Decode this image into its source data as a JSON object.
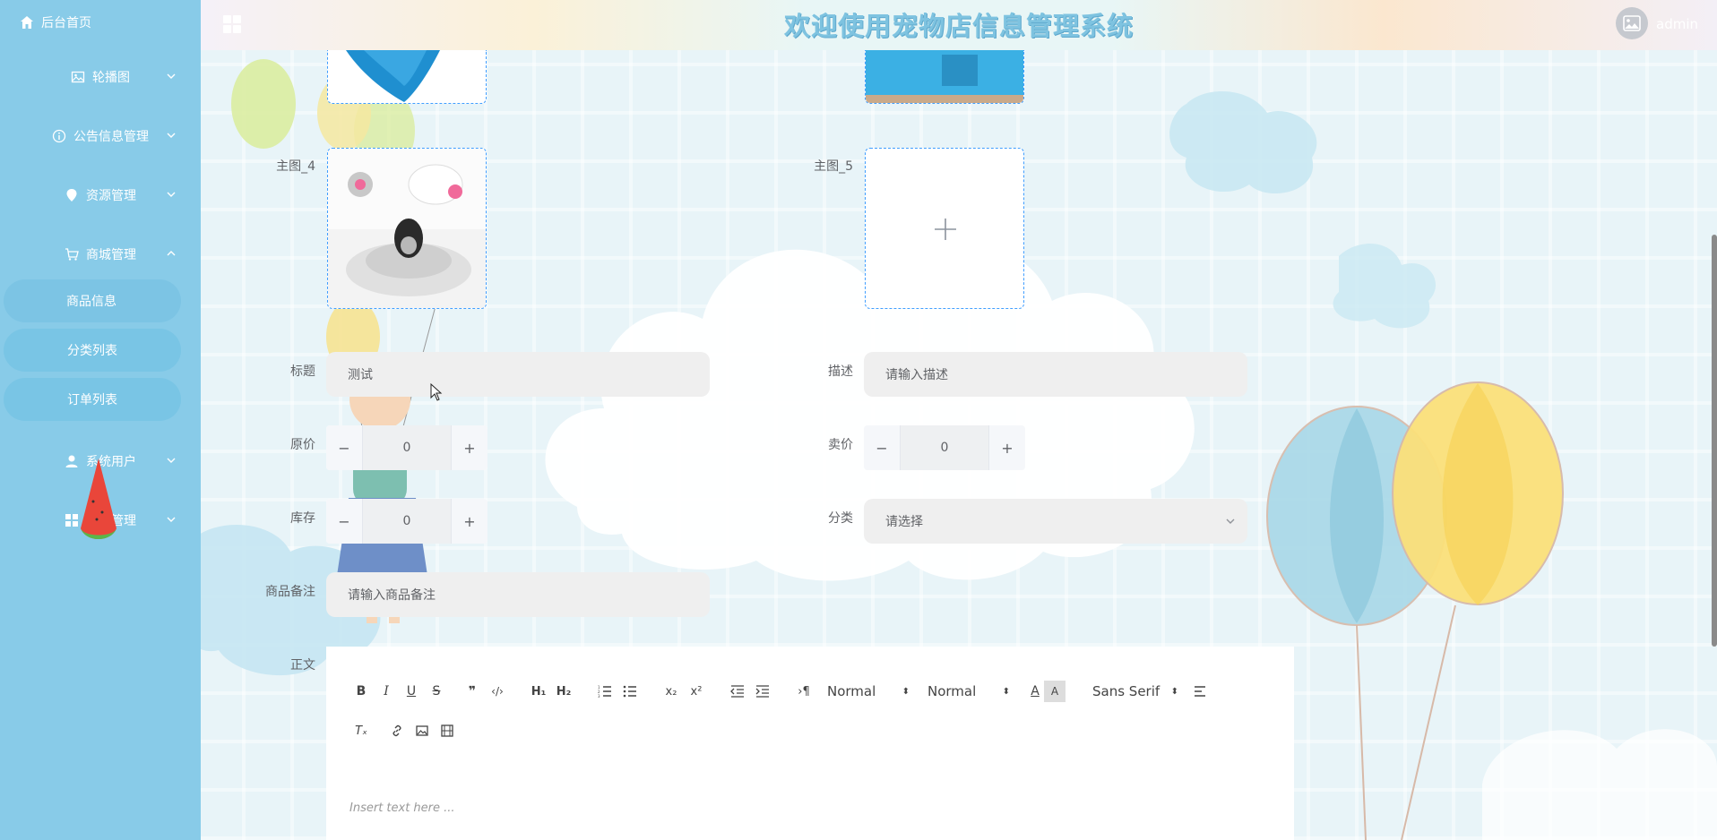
{
  "sidebar": {
    "home": "后台首页",
    "groups": [
      {
        "label": "轮播图",
        "icon": "image-icon",
        "expanded": false
      },
      {
        "label": "公告信息管理",
        "icon": "info-icon",
        "expanded": false
      },
      {
        "label": "资源管理",
        "icon": "location-icon",
        "expanded": false
      },
      {
        "label": "商城管理",
        "icon": "cart-icon",
        "expanded": true
      },
      {
        "label": "系统用户",
        "icon": "user-icon",
        "expanded": false
      },
      {
        "label": "模块管理",
        "icon": "grid-icon",
        "expanded": false
      }
    ],
    "sub_items": [
      {
        "label": "商品信息",
        "active": true
      },
      {
        "label": "分类列表",
        "active": false
      },
      {
        "label": "订单列表",
        "active": false
      }
    ]
  },
  "header": {
    "title": "欢迎使用宠物店信息管理系统",
    "user": "admin"
  },
  "form": {
    "image4_label": "主图_4",
    "image5_label": "主图_5",
    "title_label": "标题",
    "title_value": "测试",
    "desc_label": "描述",
    "desc_placeholder": "请输入描述",
    "original_price_label": "原价",
    "original_price_value": "0",
    "sale_price_label": "卖价",
    "sale_price_value": "0",
    "stock_label": "库存",
    "stock_value": "0",
    "category_label": "分类",
    "category_placeholder": "请选择",
    "remark_label": "商品备注",
    "remark_placeholder": "请输入商品备注",
    "body_label": "正文"
  },
  "editor": {
    "header_select": "Normal",
    "size_select": "Normal",
    "font_select": "Sans Serif",
    "placeholder": "Insert text here ..."
  },
  "colors": {
    "sidebar": "#88cbe8",
    "accent": "#409eff",
    "title": "#7ec3e0"
  }
}
